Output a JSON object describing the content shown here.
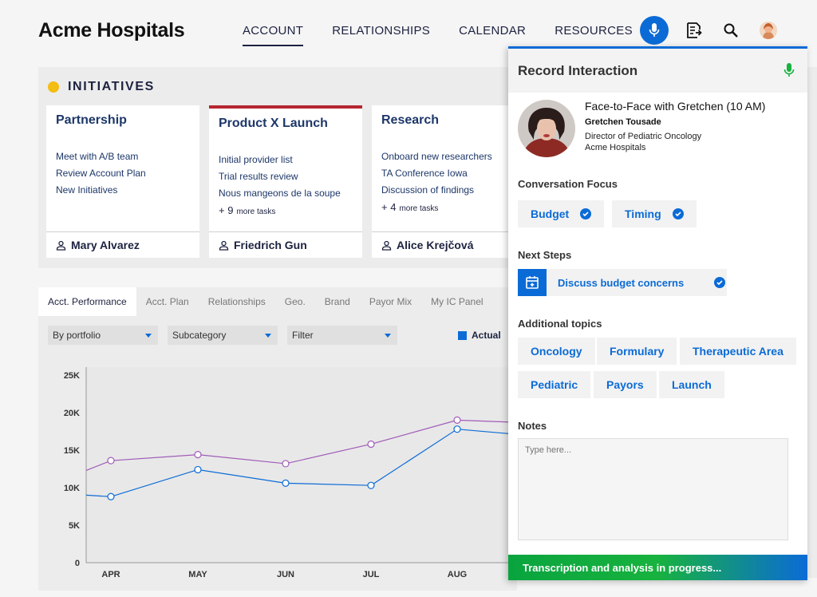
{
  "app": {
    "brand": "Acme Hospitals"
  },
  "nav": {
    "items": [
      {
        "label": "ACCOUNT",
        "active": true
      },
      {
        "label": "RELATIONSHIPS",
        "active": false
      },
      {
        "label": "CALENDAR",
        "active": false
      },
      {
        "label": "RESOURCES",
        "active": false
      }
    ]
  },
  "header_icons": [
    "microphone-icon",
    "notes-export-icon",
    "search-icon",
    "user-avatar"
  ],
  "initiatives": {
    "title": "INITIATIVES",
    "cards": [
      {
        "title": "Partnership",
        "highlight": false,
        "tasks": [
          "Meet with A/B team",
          "Review Account Plan",
          "New Initiatives"
        ],
        "more_count": "",
        "more_label": "",
        "owner": "Mary Alvarez"
      },
      {
        "title": "Product X Launch",
        "highlight": true,
        "tasks": [
          "Initial provider list",
          "Trial results review",
          "Nous mangeons de la soupe"
        ],
        "more_count": "+ 9",
        "more_label": "more tasks",
        "owner": "Friedrich Gun"
      },
      {
        "title": "Research",
        "highlight": false,
        "tasks": [
          "Onboard new researchers",
          "TA Conference Iowa",
          "Discussion of findings"
        ],
        "more_count": "+ 4",
        "more_label": "more tasks",
        "owner": "Alice Krejčová"
      }
    ]
  },
  "performance": {
    "tabs": [
      "Acct. Performance",
      "Acct. Plan",
      "Relationships",
      "Geo.",
      "Brand",
      "Payor Mix",
      "My IC Panel"
    ],
    "active_tab": 0,
    "filters": [
      "By portfolio",
      "Subcategory",
      "Filter"
    ],
    "legend": "Actual"
  },
  "chart_data": {
    "type": "line",
    "categories": [
      "APR",
      "MAY",
      "JUN",
      "JUL",
      "AUG"
    ],
    "y_ticks": [
      "0",
      "5K",
      "10K",
      "15K",
      "20K",
      "25K"
    ],
    "ylim": [
      0,
      25000
    ],
    "series": [
      {
        "name": "Actual",
        "color": "#0b6bd6",
        "values": [
          8800,
          12400,
          10600,
          10300,
          17800
        ]
      },
      {
        "name": "",
        "color": "#a05bb8",
        "values": [
          13600,
          14400,
          13200,
          15800,
          19000
        ]
      }
    ],
    "grid": false
  },
  "panel": {
    "title": "Record Interaction",
    "meeting_title": "Face-to-Face with Gretchen (10 AM)",
    "contact_name": "Gretchen Tousade",
    "contact_role": "Director of Pediatric Oncology",
    "contact_org": "Acme Hospitals",
    "focus_label": "Conversation Focus",
    "focus_chips": [
      "Budget",
      "Timing"
    ],
    "next_steps_label": "Next Steps",
    "next_step": "Discuss budget concerns",
    "topics_label": "Additional topics",
    "topics": [
      "Oncology",
      "Formulary",
      "Therapeutic Area",
      "Pediatric",
      "Payors",
      "Launch"
    ],
    "notes_label": "Notes",
    "notes_placeholder": "Type here...",
    "status": "Transcription and analysis in progress..."
  },
  "colors": {
    "accent": "#0b6bd6",
    "highlight": "#b62630",
    "mic_active": "#18b23f",
    "initiative_dot": "#f3bd12"
  }
}
